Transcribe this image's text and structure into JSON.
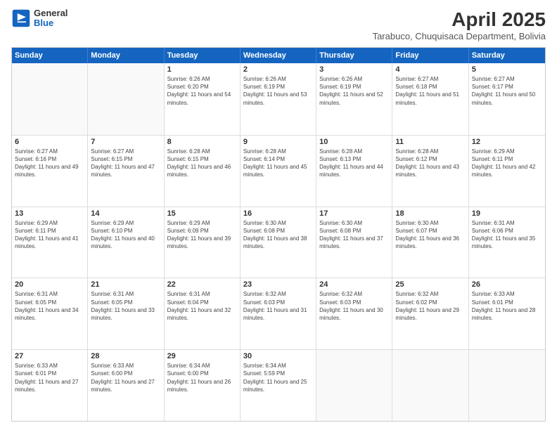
{
  "logo": {
    "line1": "General",
    "line2": "Blue"
  },
  "title": {
    "month": "April 2025",
    "location": "Tarabuco, Chuquisaca Department, Bolivia"
  },
  "header": {
    "days": [
      "Sunday",
      "Monday",
      "Tuesday",
      "Wednesday",
      "Thursday",
      "Friday",
      "Saturday"
    ]
  },
  "weeks": [
    [
      {
        "day": "",
        "info": ""
      },
      {
        "day": "",
        "info": ""
      },
      {
        "day": "1",
        "info": "Sunrise: 6:26 AM\nSunset: 6:20 PM\nDaylight: 11 hours and 54 minutes."
      },
      {
        "day": "2",
        "info": "Sunrise: 6:26 AM\nSunset: 6:19 PM\nDaylight: 11 hours and 53 minutes."
      },
      {
        "day": "3",
        "info": "Sunrise: 6:26 AM\nSunset: 6:19 PM\nDaylight: 11 hours and 52 minutes."
      },
      {
        "day": "4",
        "info": "Sunrise: 6:27 AM\nSunset: 6:18 PM\nDaylight: 11 hours and 51 minutes."
      },
      {
        "day": "5",
        "info": "Sunrise: 6:27 AM\nSunset: 6:17 PM\nDaylight: 11 hours and 50 minutes."
      }
    ],
    [
      {
        "day": "6",
        "info": "Sunrise: 6:27 AM\nSunset: 6:16 PM\nDaylight: 11 hours and 49 minutes."
      },
      {
        "day": "7",
        "info": "Sunrise: 6:27 AM\nSunset: 6:15 PM\nDaylight: 11 hours and 47 minutes."
      },
      {
        "day": "8",
        "info": "Sunrise: 6:28 AM\nSunset: 6:15 PM\nDaylight: 11 hours and 46 minutes."
      },
      {
        "day": "9",
        "info": "Sunrise: 6:28 AM\nSunset: 6:14 PM\nDaylight: 11 hours and 45 minutes."
      },
      {
        "day": "10",
        "info": "Sunrise: 6:28 AM\nSunset: 6:13 PM\nDaylight: 11 hours and 44 minutes."
      },
      {
        "day": "11",
        "info": "Sunrise: 6:28 AM\nSunset: 6:12 PM\nDaylight: 11 hours and 43 minutes."
      },
      {
        "day": "12",
        "info": "Sunrise: 6:29 AM\nSunset: 6:11 PM\nDaylight: 11 hours and 42 minutes."
      }
    ],
    [
      {
        "day": "13",
        "info": "Sunrise: 6:29 AM\nSunset: 6:11 PM\nDaylight: 11 hours and 41 minutes."
      },
      {
        "day": "14",
        "info": "Sunrise: 6:29 AM\nSunset: 6:10 PM\nDaylight: 11 hours and 40 minutes."
      },
      {
        "day": "15",
        "info": "Sunrise: 6:29 AM\nSunset: 6:09 PM\nDaylight: 11 hours and 39 minutes."
      },
      {
        "day": "16",
        "info": "Sunrise: 6:30 AM\nSunset: 6:08 PM\nDaylight: 11 hours and 38 minutes."
      },
      {
        "day": "17",
        "info": "Sunrise: 6:30 AM\nSunset: 6:08 PM\nDaylight: 11 hours and 37 minutes."
      },
      {
        "day": "18",
        "info": "Sunrise: 6:30 AM\nSunset: 6:07 PM\nDaylight: 11 hours and 36 minutes."
      },
      {
        "day": "19",
        "info": "Sunrise: 6:31 AM\nSunset: 6:06 PM\nDaylight: 11 hours and 35 minutes."
      }
    ],
    [
      {
        "day": "20",
        "info": "Sunrise: 6:31 AM\nSunset: 6:05 PM\nDaylight: 11 hours and 34 minutes."
      },
      {
        "day": "21",
        "info": "Sunrise: 6:31 AM\nSunset: 6:05 PM\nDaylight: 11 hours and 33 minutes."
      },
      {
        "day": "22",
        "info": "Sunrise: 6:31 AM\nSunset: 6:04 PM\nDaylight: 11 hours and 32 minutes."
      },
      {
        "day": "23",
        "info": "Sunrise: 6:32 AM\nSunset: 6:03 PM\nDaylight: 11 hours and 31 minutes."
      },
      {
        "day": "24",
        "info": "Sunrise: 6:32 AM\nSunset: 6:03 PM\nDaylight: 11 hours and 30 minutes."
      },
      {
        "day": "25",
        "info": "Sunrise: 6:32 AM\nSunset: 6:02 PM\nDaylight: 11 hours and 29 minutes."
      },
      {
        "day": "26",
        "info": "Sunrise: 6:33 AM\nSunset: 6:01 PM\nDaylight: 11 hours and 28 minutes."
      }
    ],
    [
      {
        "day": "27",
        "info": "Sunrise: 6:33 AM\nSunset: 6:01 PM\nDaylight: 11 hours and 27 minutes."
      },
      {
        "day": "28",
        "info": "Sunrise: 6:33 AM\nSunset: 6:00 PM\nDaylight: 11 hours and 27 minutes."
      },
      {
        "day": "29",
        "info": "Sunrise: 6:34 AM\nSunset: 6:00 PM\nDaylight: 11 hours and 26 minutes."
      },
      {
        "day": "30",
        "info": "Sunrise: 6:34 AM\nSunset: 5:59 PM\nDaylight: 11 hours and 25 minutes."
      },
      {
        "day": "",
        "info": ""
      },
      {
        "day": "",
        "info": ""
      },
      {
        "day": "",
        "info": ""
      }
    ]
  ]
}
